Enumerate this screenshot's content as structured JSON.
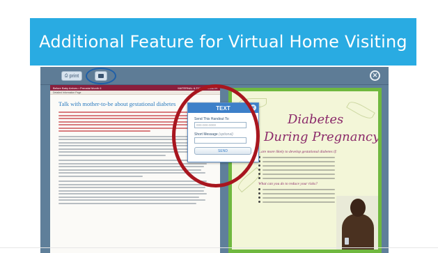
{
  "slide": {
    "title": "Additional Feature for Virtual Home Visiting",
    "colors": {
      "title_bar": "#29abe2",
      "highlight_circle": "#a8161f",
      "viewer": "#5f7f9a"
    }
  },
  "viewer": {
    "toolbar": {
      "print_label": "print",
      "text_icon": "message-icon",
      "close_icon": "close-icon"
    }
  },
  "left_page": {
    "header_left": "Before Baby Arrives • Prenatal Month 6",
    "header_right": "MATERNAL & FAMILY HEALTH",
    "sub_header": "Detailed Information Page",
    "heading": "Talk with mother-to-be about gestational diabetes"
  },
  "right_page": {
    "title_line1": "Diabetes",
    "title_line2": "During Pregnancy",
    "subheading1": "...are more likely to develop gestational diabetes if:",
    "subheading2": "What can you do to reduce your risks?"
  },
  "text_popup": {
    "title": "TEXT",
    "send_to_label": "Send This Handout To:",
    "phone_placeholder": "000-000-0000",
    "message_label": "Short Message",
    "message_optional": "(optional)",
    "send_button": "SEND"
  }
}
